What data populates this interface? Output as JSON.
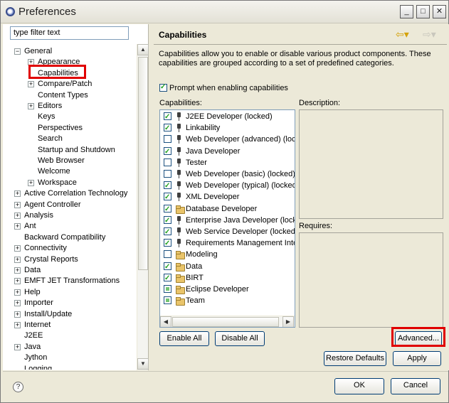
{
  "window": {
    "title": "Preferences",
    "minimize": "_",
    "maximize": "□",
    "close": "✕"
  },
  "filter": {
    "value": "type filter text"
  },
  "tree": [
    {
      "label": "General",
      "expander": "−"
    },
    {
      "label": "Appearance",
      "expander": "+"
    },
    {
      "label": "Capabilities",
      "expander": ""
    },
    {
      "label": "Compare/Patch",
      "expander": "+"
    },
    {
      "label": "Content Types",
      "expander": ""
    },
    {
      "label": "Editors",
      "expander": "+"
    },
    {
      "label": "Keys",
      "expander": ""
    },
    {
      "label": "Perspectives",
      "expander": ""
    },
    {
      "label": "Search",
      "expander": ""
    },
    {
      "label": "Startup and Shutdown",
      "expander": ""
    },
    {
      "label": "Web Browser",
      "expander": ""
    },
    {
      "label": "Welcome",
      "expander": ""
    },
    {
      "label": "Workspace",
      "expander": "+"
    },
    {
      "label": "Active Correlation Technology",
      "expander": "+"
    },
    {
      "label": "Agent Controller",
      "expander": "+"
    },
    {
      "label": "Analysis",
      "expander": "+"
    },
    {
      "label": "Ant",
      "expander": "+"
    },
    {
      "label": "Backward Compatibility",
      "expander": ""
    },
    {
      "label": "Connectivity",
      "expander": "+"
    },
    {
      "label": "Crystal Reports",
      "expander": "+"
    },
    {
      "label": "Data",
      "expander": "+"
    },
    {
      "label": "EMFT JET Transformations",
      "expander": "+"
    },
    {
      "label": "Help",
      "expander": "+"
    },
    {
      "label": "Importer",
      "expander": "+"
    },
    {
      "label": "Install/Update",
      "expander": "+"
    },
    {
      "label": "Internet",
      "expander": "+"
    },
    {
      "label": "J2EE",
      "expander": ""
    },
    {
      "label": "Java",
      "expander": "+"
    },
    {
      "label": "Jython",
      "expander": ""
    },
    {
      "label": "Logging",
      "expander": ""
    }
  ],
  "page": {
    "title": "Capabilities",
    "description": "Capabilities allow you to enable or disable various product components.  These capabilities are grouped according to a set of predefined categories.",
    "prompt_label": "Prompt when enabling capabilities",
    "capabilities_label": "Capabilities:",
    "description_label": "Description:",
    "requires_label": "Requires:"
  },
  "capabilities": [
    {
      "label": "J2EE Developer (locked)",
      "state": "on",
      "icon": "plug-icon"
    },
    {
      "label": "Linkability",
      "state": "on",
      "icon": "plug-icon"
    },
    {
      "label": "Web Developer (advanced) (locke",
      "state": "off",
      "icon": "plug-icon"
    },
    {
      "label": "Java Developer",
      "state": "on",
      "icon": "plug-icon"
    },
    {
      "label": "Tester",
      "state": "off",
      "icon": "plug-icon"
    },
    {
      "label": "Web Developer (basic) (locked)",
      "state": "off",
      "icon": "plug-icon"
    },
    {
      "label": "Web Developer (typical) (locked)",
      "state": "on",
      "icon": "plug-icon"
    },
    {
      "label": "XML Developer",
      "state": "on",
      "icon": "plug-icon"
    },
    {
      "label": "Database Developer",
      "state": "on",
      "icon": "folder-icon"
    },
    {
      "label": "Enterprise Java Developer (locke",
      "state": "on",
      "icon": "plug-icon"
    },
    {
      "label": "Web Service Developer (locked)",
      "state": "on",
      "icon": "plug-icon"
    },
    {
      "label": "Requirements Management Inte",
      "state": "on",
      "icon": "plug-icon"
    },
    {
      "label": "Modeling",
      "state": "off",
      "icon": "folder-icon"
    },
    {
      "label": "Data",
      "state": "on",
      "icon": "folder-icon"
    },
    {
      "label": "BIRT",
      "state": "on",
      "icon": "folder-icon"
    },
    {
      "label": "Eclipse Developer",
      "state": "part",
      "icon": "folder-icon"
    },
    {
      "label": "Team",
      "state": "part",
      "icon": "folder-icon"
    }
  ],
  "buttons": {
    "enable_all": "Enable All",
    "disable_all": "Disable All",
    "advanced": "Advanced...",
    "restore_defaults": "Restore Defaults",
    "apply": "Apply",
    "ok": "OK",
    "cancel": "Cancel"
  },
  "icons": {
    "back": "back-arrow-icon",
    "forward": "forward-arrow-icon",
    "help": "help-icon"
  },
  "colors": {
    "highlight": "#e00000",
    "check": "#21a121"
  }
}
